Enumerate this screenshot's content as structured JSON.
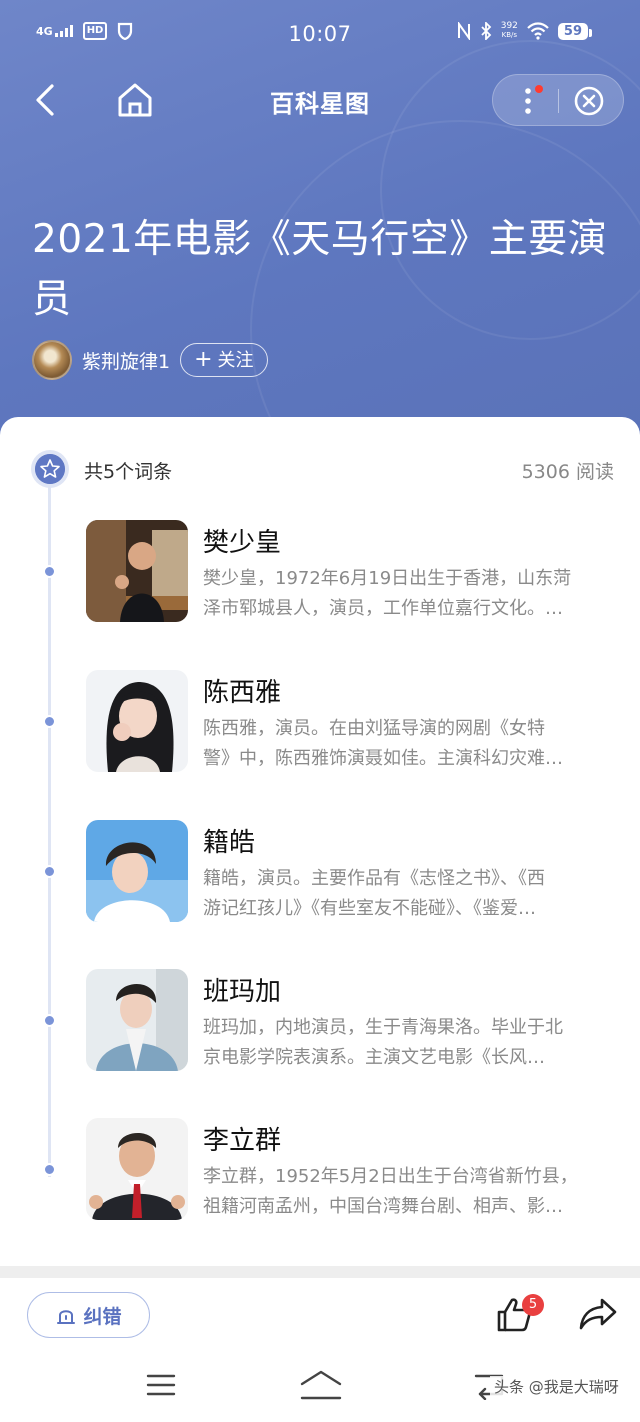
{
  "status_bar": {
    "signal": "4G",
    "hd": "HD",
    "time": "10:07",
    "net_speed_value": "392",
    "net_speed_unit": "KB/s",
    "battery": "59"
  },
  "nav": {
    "title": "百科星图"
  },
  "page": {
    "title": "2021年电影《天马行空》主要演员",
    "author": "紫荆旋律1",
    "follow_label": "关注",
    "follow_icon": "+"
  },
  "list": {
    "count_label": "共5个词条",
    "reads_label": "5306 阅读",
    "entries": [
      {
        "name": "樊少皇",
        "desc_line1": "樊少皇，1972年6月19日出生于香港，山东菏",
        "desc_line2": "泽市郓城县人，演员，工作单位嘉行文化。…"
      },
      {
        "name": "陈西雅",
        "desc_line1": "陈西雅，演员。在由刘猛导演的网剧《女特",
        "desc_line2": "警》中，陈西雅饰演聂如佳。主演科幻灾难…"
      },
      {
        "name": "籍皓",
        "desc_line1": "籍皓，演员。主要作品有《志怪之书》、《西",
        "desc_line2": "游记红孩儿》《有些室友不能碰》、《鉴爱…"
      },
      {
        "name": "班玛加",
        "desc_line1": "班玛加，内地演员，生于青海果洛。毕业于北",
        "desc_line2": "京电影学院表演系。主演文艺电影《长风…"
      },
      {
        "name": "李立群",
        "desc_line1": "李立群，1952年5月2日出生于台湾省新竹县，",
        "desc_line2": "祖籍河南孟州，中国台湾舞台剧、相声、影…"
      }
    ]
  },
  "bottom_bar": {
    "correct_label": "纠错",
    "like_count": "5"
  },
  "watermark": "头条 @我是大瑞呀",
  "colors": {
    "hero_blue": "#5e77bf",
    "accent": "#7b94d8",
    "badge_red": "#e94040"
  },
  "icons": [
    "back-icon",
    "home-icon",
    "more-icon",
    "close-icon",
    "star-badge-icon",
    "correct-icon",
    "thumbs-up-icon",
    "share-icon",
    "menu-icon",
    "system-home-icon",
    "system-back-icon"
  ]
}
